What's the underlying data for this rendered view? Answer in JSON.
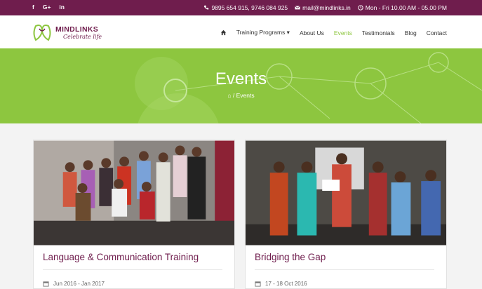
{
  "topbar": {
    "social": [
      {
        "icon": "facebook-icon",
        "label": "f"
      },
      {
        "icon": "google-plus-icon",
        "label": "G+"
      },
      {
        "icon": "linkedin-icon",
        "label": "in"
      }
    ],
    "phone": "9895 654 915, 9746 084 925",
    "email": "mail@mindlinks.in",
    "hours": "Mon - Fri 10.00 AM - 05.00 PM"
  },
  "brand": {
    "name": "MINDLINKS",
    "tagline": "Celebrate life"
  },
  "menu": {
    "home_icon": "home-icon",
    "items": [
      "Training Programs",
      "About Us",
      "Events",
      "Testimonials",
      "Blog",
      "Contact"
    ],
    "active": "Events"
  },
  "hero": {
    "title": "Events",
    "breadcrumb": "Events"
  },
  "cards": [
    {
      "title": "Language & Communication Training",
      "date": "Jun 2016 - Jan 2017"
    },
    {
      "title": "Bridging the Gap",
      "date": "17 - 18 Oct 2016"
    }
  ],
  "colors": {
    "brand": "#6f1d4d",
    "accent": "#8dc63f"
  }
}
